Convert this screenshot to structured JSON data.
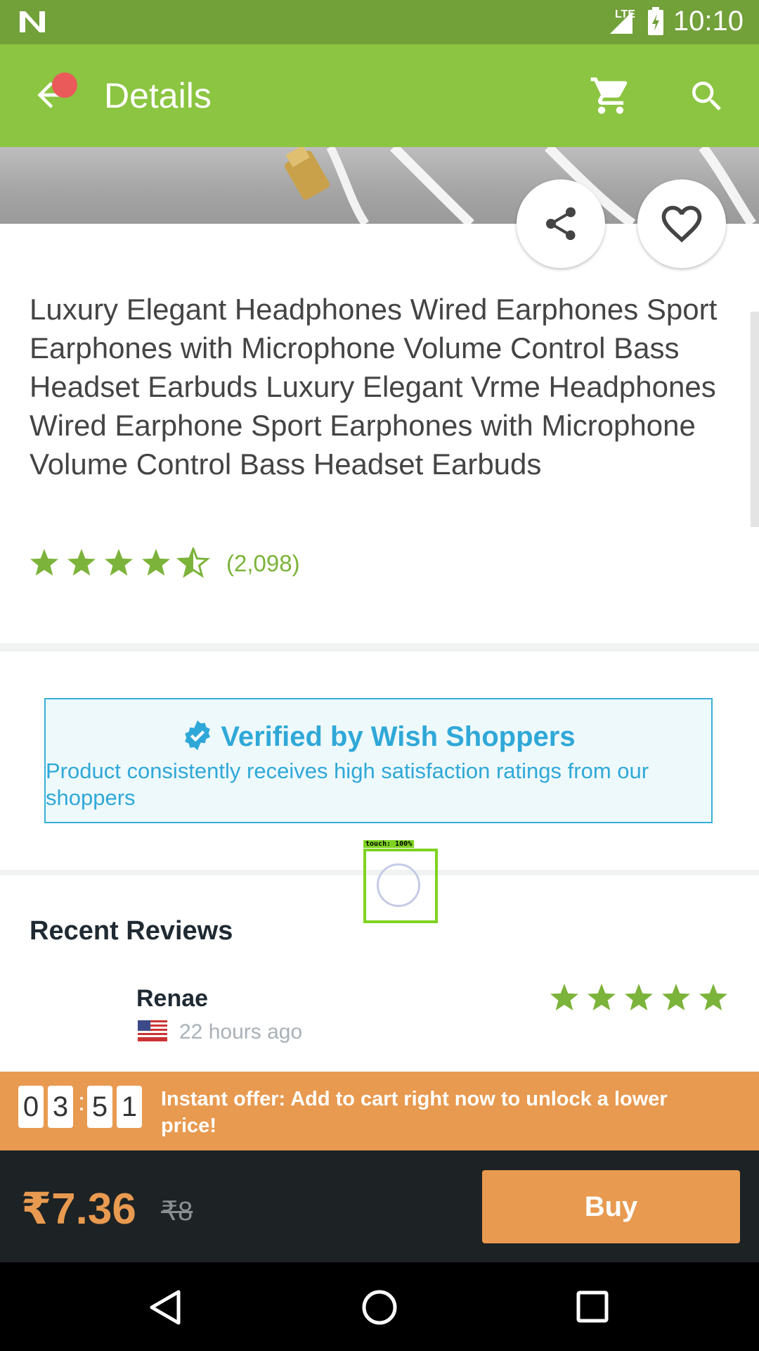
{
  "status_bar": {
    "time": "10:10",
    "network": "LTE"
  },
  "app_bar": {
    "title": "Details",
    "back_icon": "arrow-left-icon",
    "cart_icon": "cart-icon",
    "search_icon": "search-icon"
  },
  "product": {
    "title": "Luxury Elegant Headphones Wired Earphones Sport Earphones with Microphone Volume Control Bass Headset Earbuds Luxury Elegant Vrme Headphones Wired Earphone Sport Earphones with Microphone Volume Control Bass Headset Earbuds",
    "rating": 4.5,
    "rating_count": "(2,098)",
    "share_icon": "share-icon",
    "wishlist_icon": "heart-icon"
  },
  "verified": {
    "title": "Verified by Wish Shoppers",
    "body": "Product consistently receives high satisfaction ratings from our shoppers"
  },
  "touch_indicator": {
    "label": "touch: 100%"
  },
  "reviews": {
    "heading": "Recent Reviews",
    "items": [
      {
        "name": "Renae",
        "time": "22 hours ago",
        "stars": 5,
        "flag": "us-flag-icon"
      }
    ]
  },
  "offer": {
    "countdown": [
      "0",
      "3",
      "5",
      "1"
    ],
    "separator": ":",
    "text": "Instant offer: Add to cart right now to unlock a lower price!"
  },
  "purchase": {
    "price": "₹7.36",
    "old_price": "₹8",
    "buy_label": "Buy"
  },
  "colors": {
    "brand_green": "#8bc541",
    "status_green": "#72a039",
    "accent_orange": "#e89a50",
    "verified_blue": "#2fa8d8"
  }
}
